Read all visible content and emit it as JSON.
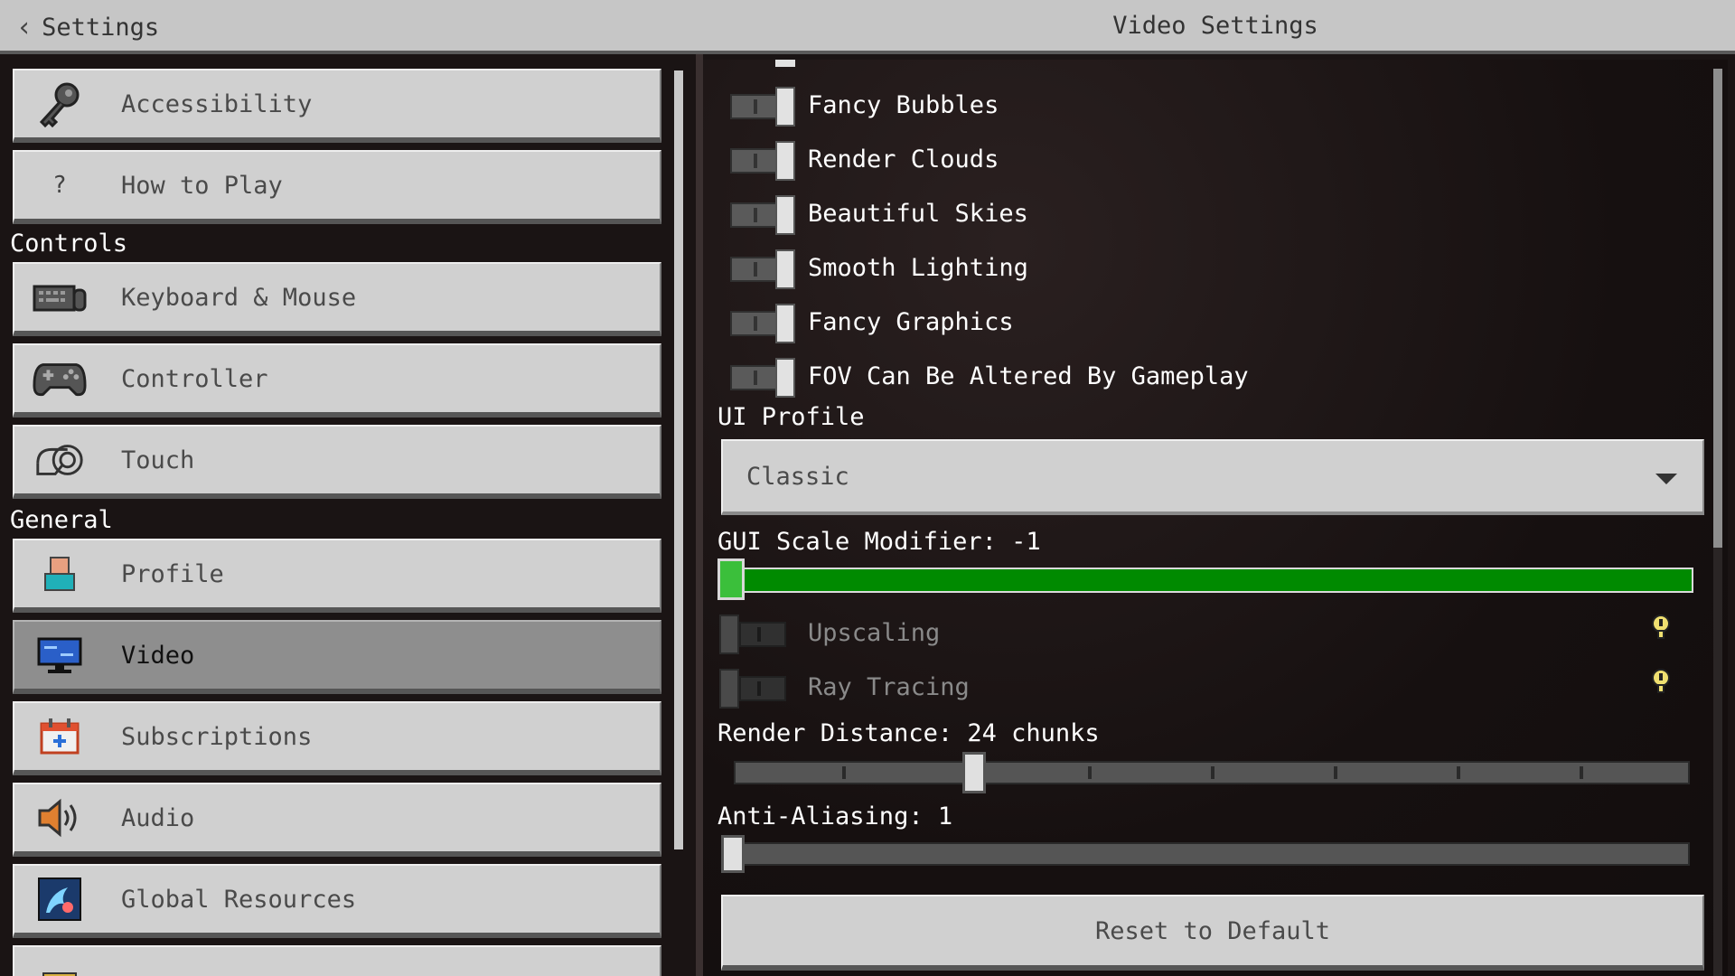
{
  "header": {
    "back_label": "Settings",
    "title": "Video Settings"
  },
  "sidebar": {
    "top_items": [
      {
        "label": "Accessibility",
        "icon": "key-icon"
      },
      {
        "label": "How to Play",
        "icon": "question-icon"
      }
    ],
    "sections": [
      {
        "title": "Controls",
        "items": [
          {
            "label": "Keyboard & Mouse",
            "icon": "keyboard-icon"
          },
          {
            "label": "Controller",
            "icon": "gamepad-icon"
          },
          {
            "label": "Touch",
            "icon": "touch-icon"
          }
        ]
      },
      {
        "title": "General",
        "items": [
          {
            "label": "Profile",
            "icon": "profile-icon"
          },
          {
            "label": "Video",
            "icon": "monitor-icon",
            "selected": true
          },
          {
            "label": "Subscriptions",
            "icon": "calendar-icon"
          },
          {
            "label": "Audio",
            "icon": "speaker-icon"
          },
          {
            "label": "Global Resources",
            "icon": "resource-pack-icon"
          }
        ]
      }
    ]
  },
  "video": {
    "toggles": [
      {
        "label": "Fancy Bubbles",
        "on": true
      },
      {
        "label": "Render Clouds",
        "on": true
      },
      {
        "label": "Beautiful Skies",
        "on": true
      },
      {
        "label": "Smooth Lighting",
        "on": true
      },
      {
        "label": "Fancy Graphics",
        "on": true
      },
      {
        "label": "FOV Can Be Altered By Gameplay",
        "on": true
      }
    ],
    "ui_profile": {
      "label": "UI Profile",
      "value": "Classic"
    },
    "gui_scale": {
      "label": "GUI Scale Modifier: -1",
      "value": -1
    },
    "disabled_toggles": [
      {
        "label": "Upscaling",
        "on": false
      },
      {
        "label": "Ray Tracing",
        "on": false
      }
    ],
    "render_distance": {
      "label": "Render Distance: 24 chunks",
      "fraction": 0.245
    },
    "anti_aliasing": {
      "label": "Anti-Aliasing: 1",
      "fraction": 0.0
    },
    "reset_label": "Reset to Default"
  },
  "colors": {
    "accent_green": "#008a00",
    "selected": "#8e8e8e",
    "button": "#d0d0d0"
  }
}
